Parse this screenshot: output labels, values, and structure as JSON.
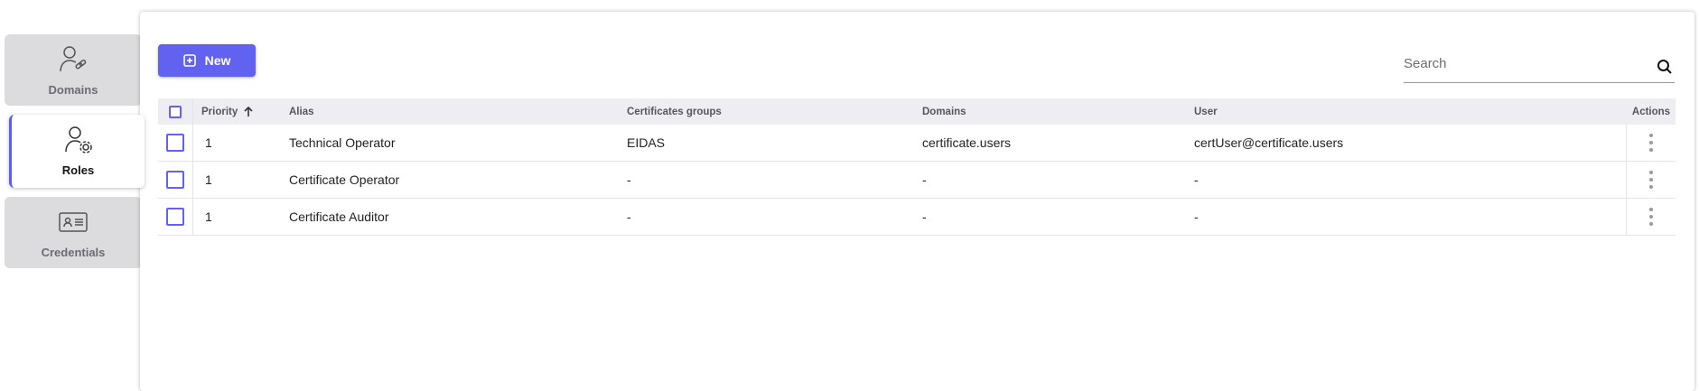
{
  "sidebar": {
    "tabs": [
      {
        "label": "Domains",
        "icon": "user-link-icon",
        "active": false
      },
      {
        "label": "Roles",
        "icon": "user-gear-icon",
        "active": true
      },
      {
        "label": "Credentials",
        "icon": "id-card-icon",
        "active": false
      }
    ]
  },
  "toolbar": {
    "new_label": "New",
    "search_placeholder": "Search"
  },
  "table": {
    "columns": [
      "Priority",
      "Alias",
      "Certificates groups",
      "Domains",
      "User",
      "Actions"
    ],
    "sort": {
      "column": "Priority",
      "direction": "ascending"
    },
    "rows": [
      {
        "priority": "1",
        "alias": "Technical Operator",
        "certificates_groups": "EIDAS",
        "domains": "certificate.users",
        "user": "certUser@certificate.users"
      },
      {
        "priority": "1",
        "alias": "Certificate Operator",
        "certificates_groups": "-",
        "domains": "-",
        "user": "-"
      },
      {
        "priority": "1",
        "alias": "Certificate Auditor",
        "certificates_groups": "-",
        "domains": "-",
        "user": "-"
      }
    ]
  },
  "colors": {
    "accent": "#6262f0",
    "header_bg": "#eeeef2",
    "inactive_tab_bg": "#dcdcde"
  }
}
